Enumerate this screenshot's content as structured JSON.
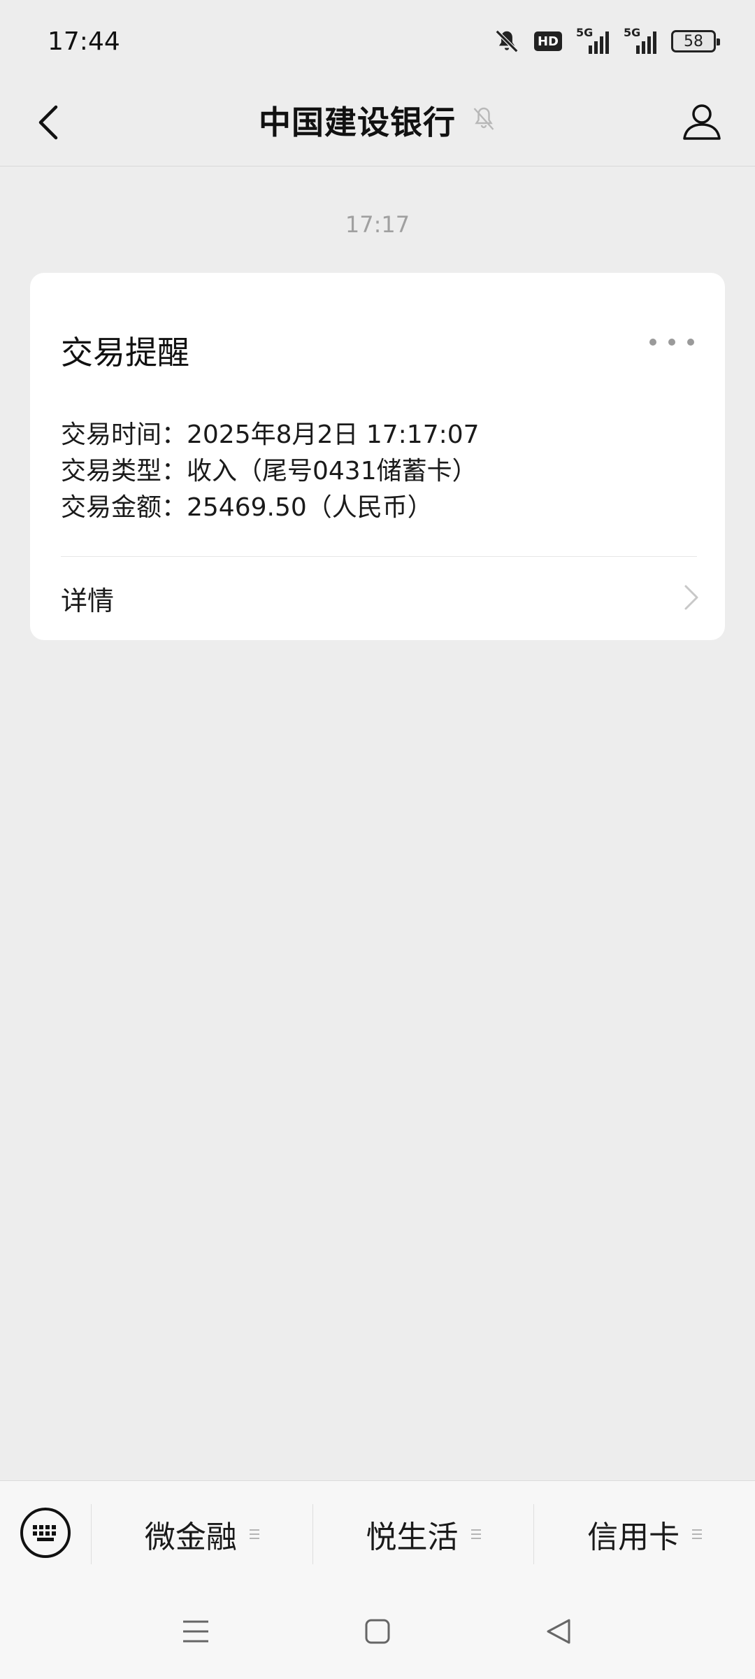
{
  "status_bar": {
    "time": "17:44",
    "network_label_1": "5G",
    "network_label_2": "5G",
    "hd_label": "HD",
    "battery_level": "58",
    "icons": [
      "bell-mute-icon",
      "hd-voice-icon",
      "signal-5g-icon",
      "signal-5g-icon",
      "battery-icon"
    ]
  },
  "header": {
    "title": "中国建设银行",
    "icons": [
      "back-arrow-icon",
      "notification-off-icon",
      "profile-icon"
    ]
  },
  "chat": {
    "timestamp": "17:17",
    "card": {
      "title": "交易提醒",
      "lines": [
        "交易时间：2025年8月2日 17:17:07",
        "交易类型：收入（尾号0431储蓄卡）",
        "交易金额：25469.50（人民币）"
      ],
      "detail_label": "详情",
      "icons": [
        "more-icon",
        "chevron-right-icon"
      ]
    }
  },
  "menu": {
    "items": [
      {
        "label": "微金融"
      },
      {
        "label": "悦生活"
      },
      {
        "label": "信用卡"
      }
    ],
    "icons": [
      "keyboard-icon",
      "submenu-icon"
    ]
  },
  "nav": {
    "icons": [
      "menu-icon",
      "home-icon",
      "back-icon"
    ]
  }
}
